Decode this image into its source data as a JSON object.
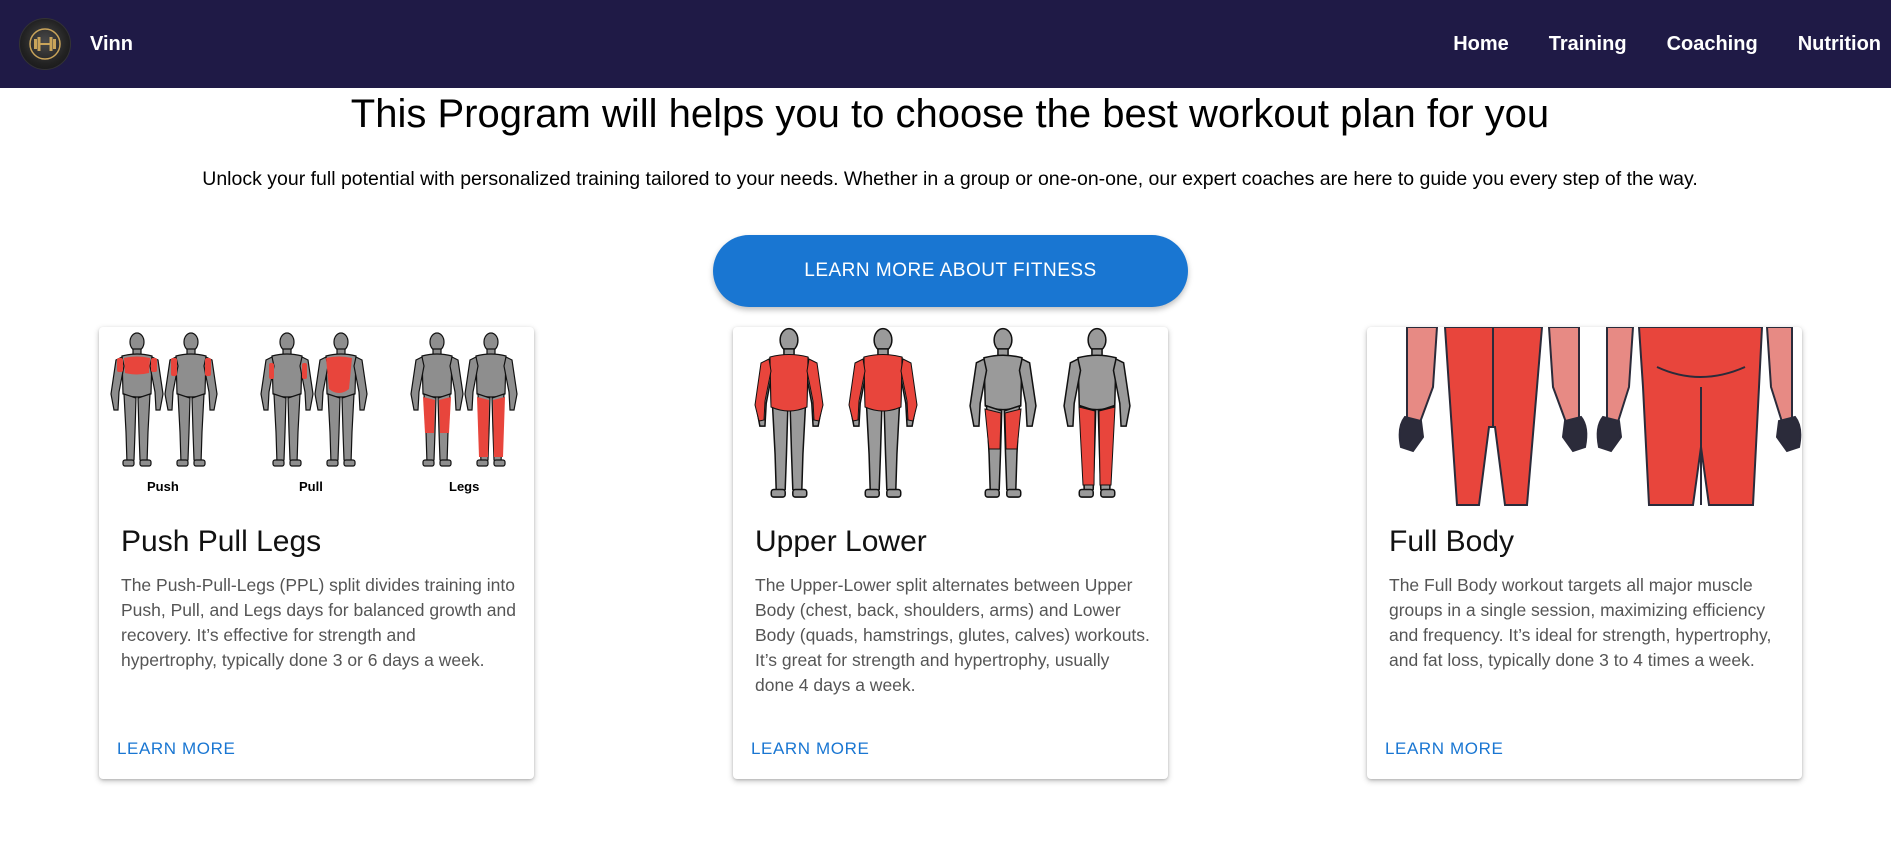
{
  "navbar": {
    "brand": "Vinn",
    "links": [
      "Home",
      "Training",
      "Coaching",
      "Nutrition"
    ]
  },
  "hero": {
    "title": "This Program will helps you to choose the best workout plan for you",
    "subtitle": "Unlock your full potential with personalized training tailored to your needs. Whether in a group or one-on-one, our expert coaches are here to guide you every step of the way.",
    "cta": "LEARN MORE ABOUT FITNESS"
  },
  "cards": [
    {
      "title": "Push Pull Legs",
      "description": "The Push-Pull-Legs (PPL) split divides training into Push, Pull, and Legs days for balanced growth and recovery. It’s effective for strength and hypertrophy, typically done 3 or 6 days a week.",
      "link": "LEARN MORE",
      "image_labels": [
        "Push",
        "Pull",
        "Legs"
      ]
    },
    {
      "title": "Upper Lower",
      "description": "The Upper-Lower split alternates between Upper Body (chest, back, shoulders, arms) and Lower Body (quads, hamstrings, glutes, calves) workouts. It’s great for strength and hypertrophy, usually done 4 days a week.",
      "link": "LEARN MORE"
    },
    {
      "title": "Full Body",
      "description": "The Full Body workout targets all major muscle groups in a single session, maximizing efficiency and frequency. It’s ideal for strength, hypertrophy, and fat loss, typically done 3 to 4 times a week.",
      "link": "LEARN MORE"
    }
  ],
  "colors": {
    "navbar_bg": "#1f1a46",
    "accent": "#1976d2",
    "muscle_highlight": "#e8453c",
    "muscle_base": "#9a9a9a"
  }
}
